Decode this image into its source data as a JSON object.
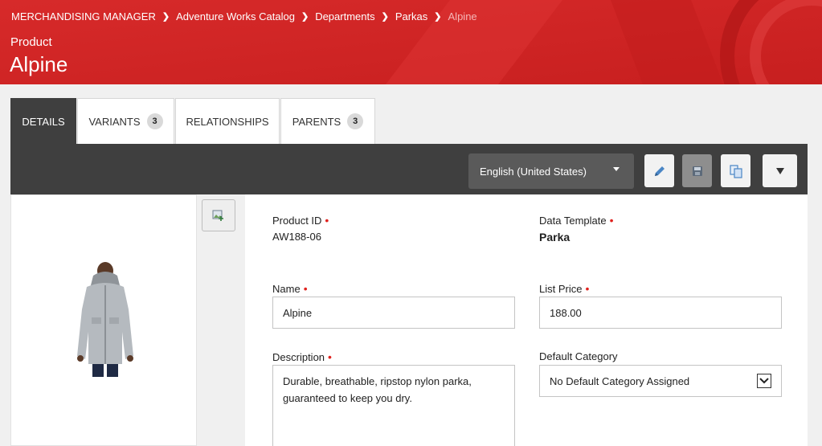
{
  "header": {
    "breadcrumbs": [
      {
        "label": "MERCHANDISING MANAGER"
      },
      {
        "label": "Adventure Works Catalog"
      },
      {
        "label": "Departments"
      },
      {
        "label": "Parkas"
      },
      {
        "label": "Alpine"
      }
    ],
    "entity_type": "Product",
    "entity_name": "Alpine"
  },
  "tabs": [
    {
      "label": "DETAILS",
      "active": true
    },
    {
      "label": "VARIANTS",
      "count": "3"
    },
    {
      "label": "RELATIONSHIPS"
    },
    {
      "label": "PARENTS",
      "count": "3"
    }
  ],
  "toolbar": {
    "language": "English (United States)",
    "icons": [
      "pencil-icon",
      "save-icon",
      "copy-icon",
      "caret-down-icon"
    ]
  },
  "form": {
    "product_id_label": "Product ID",
    "product_id_value": "AW188-06",
    "data_template_label": "Data Template",
    "data_template_value": "Parka",
    "name_label": "Name",
    "name_value": "Alpine",
    "list_price_label": "List Price",
    "list_price_value": "188.00",
    "description_label": "Description",
    "description_value": "Durable, breathable, ripstop nylon parka, guaranteed to keep you dry.",
    "default_category_label": "Default Category",
    "default_category_value": "No Default Category Assigned",
    "required_marker": "•"
  },
  "colors": {
    "brand_red": "#d42626",
    "toolbar_dark": "#3f3f3f",
    "required_red": "#e0221e"
  }
}
